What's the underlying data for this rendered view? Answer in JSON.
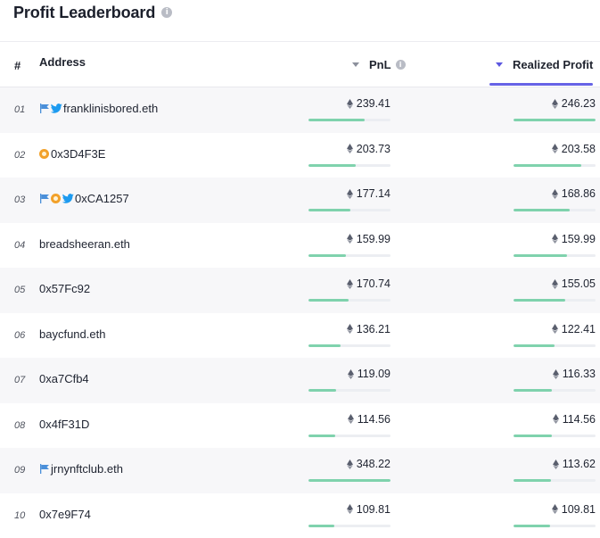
{
  "page": {
    "title": "Profit Leaderboard",
    "info_icon": "info-icon"
  },
  "table": {
    "headers": {
      "rank": "#",
      "address": "Address",
      "pnl": "PnL",
      "realized_profit": "Realized Profit"
    },
    "sorted_by": "Realized Profit",
    "accent_color": "#6763e6",
    "bar_color": "#7fd2ad",
    "rows": [
      {
        "rank": "01",
        "address": "franklinisbored.eth",
        "icons": [
          "flag",
          "twitter"
        ],
        "pnl": "239.41",
        "pnl_bar": 0.69,
        "realized_profit": "246.23",
        "rp_bar": 1.0
      },
      {
        "rank": "02",
        "address": "0x3D4F3E",
        "icons": [
          "coin"
        ],
        "pnl": "203.73",
        "pnl_bar": 0.58,
        "realized_profit": "203.58",
        "rp_bar": 0.83
      },
      {
        "rank": "03",
        "address": "0xCA1257",
        "icons": [
          "flag",
          "coin",
          "twitter"
        ],
        "pnl": "177.14",
        "pnl_bar": 0.51,
        "realized_profit": "168.86",
        "rp_bar": 0.69
      },
      {
        "rank": "04",
        "address": "breadsheeran.eth",
        "icons": [],
        "pnl": "159.99",
        "pnl_bar": 0.46,
        "realized_profit": "159.99",
        "rp_bar": 0.65
      },
      {
        "rank": "05",
        "address": "0x57Fc92",
        "icons": [],
        "pnl": "170.74",
        "pnl_bar": 0.49,
        "realized_profit": "155.05",
        "rp_bar": 0.63
      },
      {
        "rank": "06",
        "address": "baycfund.eth",
        "icons": [],
        "pnl": "136.21",
        "pnl_bar": 0.39,
        "realized_profit": "122.41",
        "rp_bar": 0.5
      },
      {
        "rank": "07",
        "address": "0xa7Cfb4",
        "icons": [],
        "pnl": "119.09",
        "pnl_bar": 0.34,
        "realized_profit": "116.33",
        "rp_bar": 0.47
      },
      {
        "rank": "08",
        "address": "0x4fF31D",
        "icons": [],
        "pnl": "114.56",
        "pnl_bar": 0.33,
        "realized_profit": "114.56",
        "rp_bar": 0.47
      },
      {
        "rank": "09",
        "address": "jrnynftclub.eth",
        "icons": [
          "flag"
        ],
        "pnl": "348.22",
        "pnl_bar": 1.0,
        "realized_profit": "113.62",
        "rp_bar": 0.46
      },
      {
        "rank": "10",
        "address": "0x7e9F74",
        "icons": [],
        "pnl": "109.81",
        "pnl_bar": 0.32,
        "realized_profit": "109.81",
        "rp_bar": 0.45
      }
    ]
  }
}
